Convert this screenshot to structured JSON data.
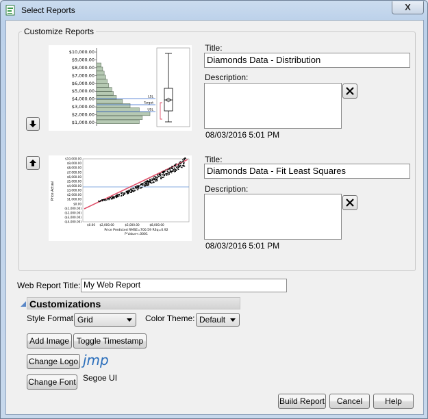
{
  "window": {
    "title": "Select Reports",
    "close_label": "X"
  },
  "group": {
    "legend": "Customize Reports"
  },
  "reports": [
    {
      "title_label": "Title:",
      "title_value": "Diamonds Data - Distribution",
      "description_label": "Description:",
      "timestamp": "08/03/2016 5:01 PM"
    },
    {
      "title_label": "Title:",
      "title_value": "Diamonds Data - Fit Least Squares",
      "description_label": "Description:",
      "timestamp": "08/03/2016 5:01 PM"
    }
  ],
  "distribution_thumb": {
    "tick_labels": [
      "$10,000.00",
      "$9,000.00",
      "$8,000.00",
      "$7,000.00",
      "$6,000.00",
      "$5,000.00",
      "$4,000.00",
      "$3,000.00",
      "$2,000.00",
      "$1,000.00"
    ],
    "bar_values": [
      3,
      4,
      5,
      6,
      7,
      8,
      10,
      11,
      13,
      17,
      22,
      28,
      35,
      30,
      28
    ],
    "bar_color": "#b6c9b3",
    "ref_line_labels": [
      "LSL",
      "Target",
      "USL"
    ]
  },
  "fit_thumb": {
    "y_axis_label": "Price Actual",
    "x_axis_label": "Price Predicted RMSE=700.59 RSq=0.92",
    "x_axis_sublabel": "P Value<.0001",
    "y_tick_labels": [
      "$10,000.00",
      "$9,000.00",
      "$8,000.00",
      "$7,000.00",
      "$6,000.00",
      "$5,000.00",
      "$4,000.00",
      "$3,000.00",
      "$2,000.00",
      "$1,000.00",
      "$0.00",
      "($1,000.00)",
      "($2,000.00)",
      "($3,000.00)",
      "($4,000.00)"
    ],
    "x_tick_labels": [
      "$0.00",
      "$2,000.00",
      "$5,000.00",
      "$8,000.00"
    ],
    "fit_line_color": "#e0506a",
    "mean_line_color": "#5b8fd6"
  },
  "web_report": {
    "label": "Web Report Title:",
    "value": "My Web Report"
  },
  "customizations": {
    "header": "Customizations",
    "style_format_label": "Style Format:",
    "style_format_value": "Grid",
    "color_theme_label": "Color Theme:",
    "color_theme_value": "Default",
    "add_image_label": "Add Image",
    "toggle_timestamp_label": "Toggle Timestamp",
    "change_logo_label": "Change Logo",
    "logo_text": "jmp",
    "change_font_label": "Change Font",
    "font_name": "Segoe UI"
  },
  "footer": {
    "build_label": "Build Report",
    "cancel_label": "Cancel",
    "help_label": "Help"
  },
  "colors": {
    "window_frame": "#bcd1ea",
    "client_bg": "#f0f0f0",
    "logo_blue": "#2a6ebb"
  }
}
